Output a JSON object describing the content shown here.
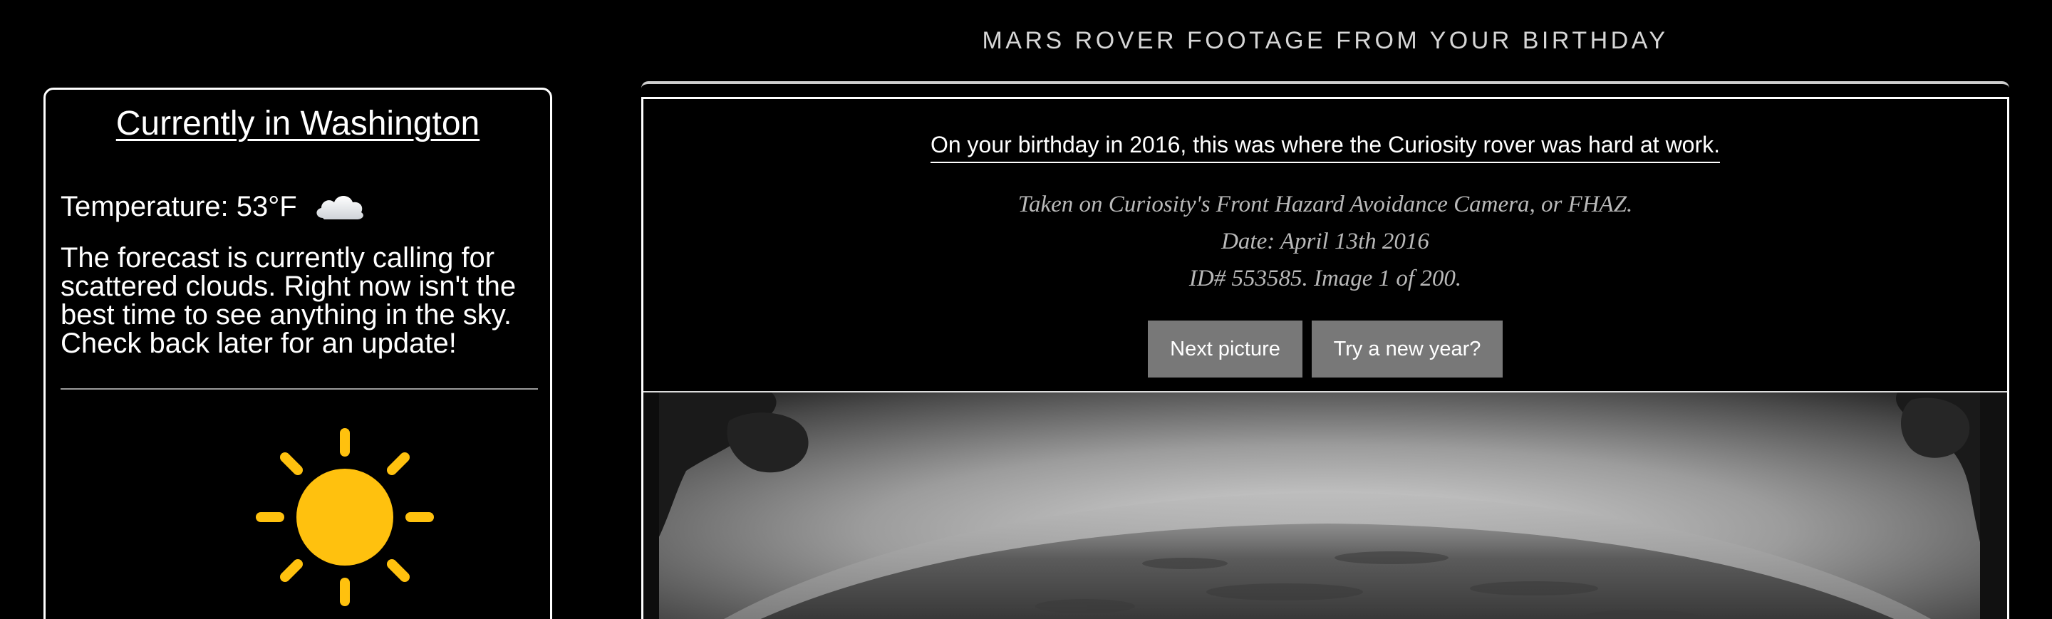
{
  "weather": {
    "title": "Currently in Washington",
    "temperature_label": "Temperature: 53°F",
    "condition_icon": "cloud-icon",
    "forecast_text": "The forecast is currently calling for scattered clouds. Right now isn't the best time to see anything in the sky. Check back later for an update!",
    "visual_icon": "sun-icon",
    "sun_color": "#FFC10E"
  },
  "mars": {
    "heading": "MARS ROVER FOOTAGE FROM YOUR BIRTHDAY",
    "intro": "On your birthday in 2016, this was where the Curiosity rover was hard at work.",
    "camera": "Taken on Curiosity's Front Hazard Avoidance Camera, or FHAZ.",
    "date": "Date: April 13th 2016",
    "image_id": "ID# 553585. Image 1 of 200.",
    "buttons": {
      "next": "Next picture",
      "new_year": "Try a new year?"
    },
    "button_color": "#787878"
  }
}
